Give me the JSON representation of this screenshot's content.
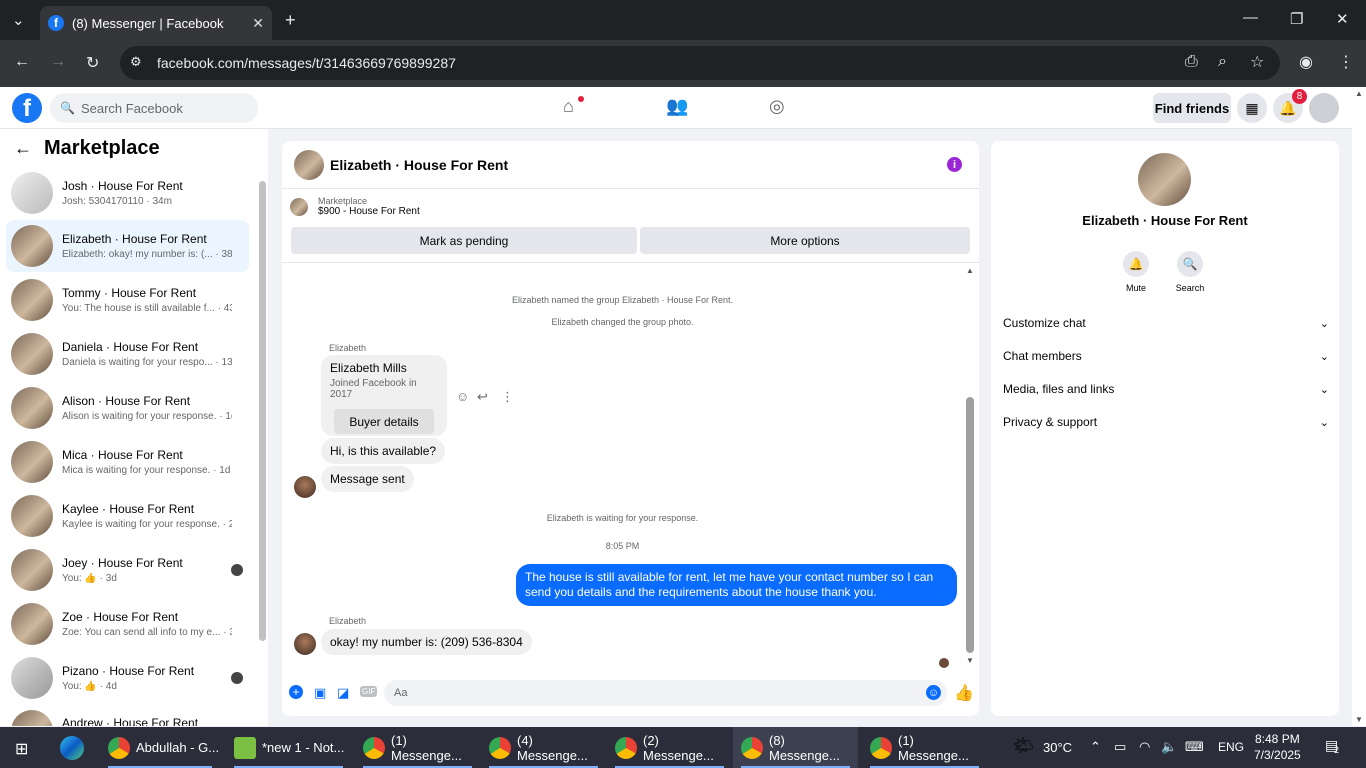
{
  "browser": {
    "tab_title": "(8) Messenger | Facebook",
    "url": "facebook.com/messages/t/31463669769899287"
  },
  "fb_header": {
    "search_placeholder": "Search Facebook",
    "find_friends": "Find friends",
    "notification_count": "8"
  },
  "sidebar": {
    "title": "Marketplace",
    "conversations": [
      {
        "name": "Josh · House For Rent",
        "preview": "Josh: 5304170110 · 34m"
      },
      {
        "name": "Elizabeth · House For Rent",
        "preview": "Elizabeth: okay! my number is: (... · 38m"
      },
      {
        "name": "Tommy · House For Rent",
        "preview": "You: The house is still available f... · 43m"
      },
      {
        "name": "Daniela · House For Rent",
        "preview": "Daniela is waiting for your respo... · 13h"
      },
      {
        "name": "Alison · House For Rent",
        "preview": "Alison is waiting for your response. · 1d"
      },
      {
        "name": "Mica · House For Rent",
        "preview": "Mica is waiting for your response. · 1d"
      },
      {
        "name": "Kaylee · House For Rent",
        "preview": "Kaylee is waiting for your response. · 2d"
      },
      {
        "name": "Joey · House For Rent",
        "preview": "You: 👍 · 3d"
      },
      {
        "name": "Zoe · House For Rent",
        "preview": "Zoe: You can send all info to my e... · 3d"
      },
      {
        "name": "Pizano · House For Rent",
        "preview": "You: 👍 · 4d"
      },
      {
        "name": "Andrew · House For Rent",
        "preview": ""
      }
    ]
  },
  "chat": {
    "title": "Elizabeth · House For Rent",
    "listing_label": "Marketplace",
    "listing_price": "$900 - House For Rent",
    "mark_pending": "Mark as pending",
    "more_options": "More options",
    "sys1": "Elizabeth named the group Elizabeth · House For Rent.",
    "sys2": "Elizabeth changed the group photo.",
    "sender": "Elizabeth",
    "card_name": "Elizabeth Mills",
    "card_sub": "Joined Facebook in 2017",
    "buyer_details": "Buyer details",
    "msg1": "Hi, is this available?",
    "msg2": "Message sent",
    "waiting": "Elizabeth is waiting for your response.",
    "time": "8:05 PM",
    "my_msg": "The house is still available for rent, let me have your contact number so I can send you details and the requirements about the house thank you.",
    "sender2": "Elizabeth",
    "reply": "okay! my number is: (209) 536-8304",
    "input_placeholder": "Aa"
  },
  "right_panel": {
    "name": "Elizabeth · House For Rent",
    "mute": "Mute",
    "search": "Search",
    "sections": [
      "Customize chat",
      "Chat members",
      "Media, files and links",
      "Privacy & support"
    ]
  },
  "taskbar": {
    "items": [
      "Abdullah - G...",
      "*new 1 - Not...",
      "(1) Messenge...",
      "(4) Messenge...",
      "(2) Messenge...",
      "(8) Messenge...",
      "(1) Messenge..."
    ],
    "temperature": "30°C",
    "language": "ENG",
    "time": "8:48 PM",
    "date": "7/3/2025",
    "notif_count": "2"
  },
  "colors": {
    "fb_blue": "#1877f2",
    "my_bubble": "#0a6cff",
    "info_purple": "#9b26d8"
  }
}
